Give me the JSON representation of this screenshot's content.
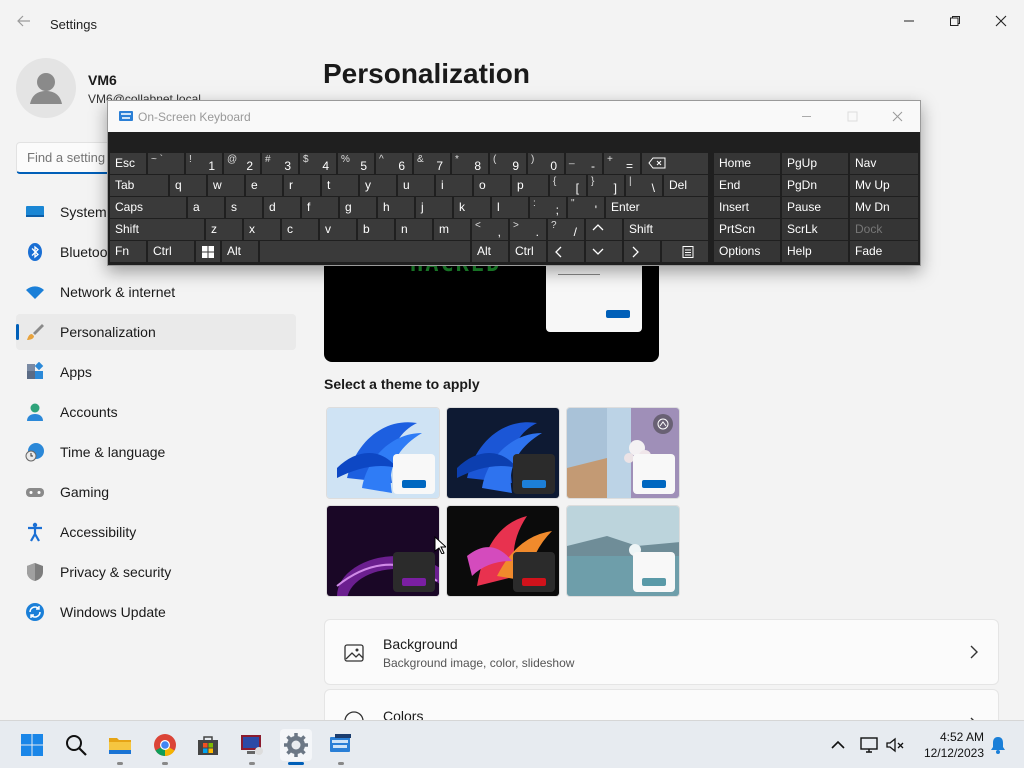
{
  "window": {
    "title": "Settings"
  },
  "user": {
    "name": "VM6",
    "email": "VM6@collabnet.local"
  },
  "search": {
    "placeholder": "Find a setting"
  },
  "nav": {
    "items": [
      {
        "label": "System",
        "icon": "monitor-icon"
      },
      {
        "label": "Bluetooth & devices",
        "icon": "bluetooth-icon"
      },
      {
        "label": "Network & internet",
        "icon": "wifi-icon"
      },
      {
        "label": "Personalization",
        "icon": "brush-icon",
        "active": true
      },
      {
        "label": "Apps",
        "icon": "apps-icon"
      },
      {
        "label": "Accounts",
        "icon": "person-icon"
      },
      {
        "label": "Time & language",
        "icon": "globe-clock-icon"
      },
      {
        "label": "Gaming",
        "icon": "gamepad-icon"
      },
      {
        "label": "Accessibility",
        "icon": "accessibility-icon"
      },
      {
        "label": "Privacy & security",
        "icon": "shield-icon"
      },
      {
        "label": "Windows Update",
        "icon": "update-icon"
      }
    ]
  },
  "main": {
    "title": "Personalization",
    "preview_text": "HACKED",
    "themes_label": "Select a theme to apply",
    "cards": [
      {
        "title": "Background",
        "subtitle": "Background image, color, slideshow",
        "icon": "image-icon"
      },
      {
        "title": "Colors",
        "subtitle": "",
        "icon": "palette-icon"
      }
    ]
  },
  "osk": {
    "title": "On-Screen Keyboard",
    "rows": {
      "r1_left": "Esc",
      "r1_nums": [
        [
          "~ `",
          ""
        ],
        [
          "!",
          "1"
        ],
        [
          "@",
          "2"
        ],
        [
          "#",
          "3"
        ],
        [
          "$",
          "4"
        ],
        [
          "%",
          "5"
        ],
        [
          "^",
          "6"
        ],
        [
          "&",
          "7"
        ],
        [
          "*",
          "8"
        ],
        [
          "(",
          "9"
        ],
        [
          ")",
          "0"
        ],
        [
          "_",
          "-"
        ],
        [
          "+",
          "="
        ]
      ],
      "r2": [
        "Tab",
        "q",
        "w",
        "e",
        "r",
        "t",
        "y",
        "u",
        "i",
        "o",
        "p"
      ],
      "r2_sym": [
        [
          "{",
          "["
        ],
        [
          "}",
          "]"
        ],
        [
          "|",
          "\\"
        ]
      ],
      "r2_del": "Del",
      "r3": [
        "Caps",
        "a",
        "s",
        "d",
        "f",
        "g",
        "h",
        "j",
        "k",
        "l"
      ],
      "r3_sym": [
        [
          ":",
          ";"
        ],
        [
          "\"",
          "'"
        ]
      ],
      "r3_enter": "Enter",
      "r4": [
        "Shift",
        "z",
        "x",
        "c",
        "v",
        "b",
        "n",
        "m"
      ],
      "r4_sym": [
        [
          "<",
          ","
        ],
        [
          ">",
          "."
        ],
        [
          "?",
          "/"
        ]
      ],
      "r4_shift_r": "Shift",
      "r5": {
        "fn": "Fn",
        "ctrl": "Ctrl",
        "alt": "Alt",
        "alt_r": "Alt",
        "ctrl_r": "Ctrl"
      }
    },
    "nav_keys": [
      [
        "Home",
        "PgUp",
        "Nav"
      ],
      [
        "End",
        "PgDn",
        "Mv Up"
      ],
      [
        "Insert",
        "Pause",
        "Mv Dn"
      ],
      [
        "PrtScn",
        "ScrLk",
        "Dock"
      ],
      [
        "Options",
        "Help",
        "Fade"
      ]
    ]
  },
  "taskbar": {
    "time": "4:52 AM",
    "date": "12/12/2023",
    "apps": [
      "start-icon",
      "search-icon",
      "file-explorer-icon",
      "chrome-icon",
      "store-icon",
      "remote-desktop-icon",
      "settings-icon",
      "osk-icon"
    ]
  },
  "colors": {
    "accent": "#005fb8",
    "osk_bg": "#1f1f1f",
    "osk_key": "#3a3a3a"
  }
}
